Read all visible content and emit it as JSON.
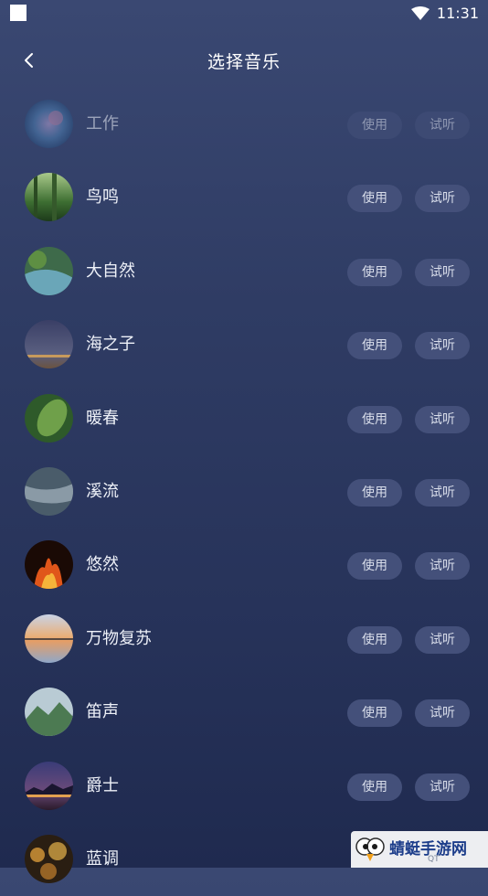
{
  "status": {
    "time": "11:31",
    "icons": [
      "square-icon",
      "wifi-icon"
    ]
  },
  "header": {
    "title": "选择音乐",
    "back_icon": "chevron-left-icon"
  },
  "buttons": {
    "use_label": "使用",
    "try_label": "试听"
  },
  "tracks": [
    {
      "name": "工作",
      "disabled": true,
      "thumb": "nebula"
    },
    {
      "name": "鸟鸣",
      "thumb": "forest"
    },
    {
      "name": "大自然",
      "thumb": "stream"
    },
    {
      "name": "海之子",
      "thumb": "night-sea"
    },
    {
      "name": "暖春",
      "thumb": "leaf"
    },
    {
      "name": "溪流",
      "thumb": "river"
    },
    {
      "name": "悠然",
      "thumb": "fire"
    },
    {
      "name": "万物复苏",
      "thumb": "sunset"
    },
    {
      "name": "笛声",
      "thumb": "mountain"
    },
    {
      "name": "爵士",
      "thumb": "city-night"
    },
    {
      "name": "蓝调",
      "thumb": "bokeh"
    }
  ],
  "watermark": {
    "text": "蜻蜓手游网",
    "sub": "QT"
  },
  "colors": {
    "background_top": "#3a4872",
    "background_bottom": "#1f2a4f",
    "button_bg": "#44507a"
  }
}
